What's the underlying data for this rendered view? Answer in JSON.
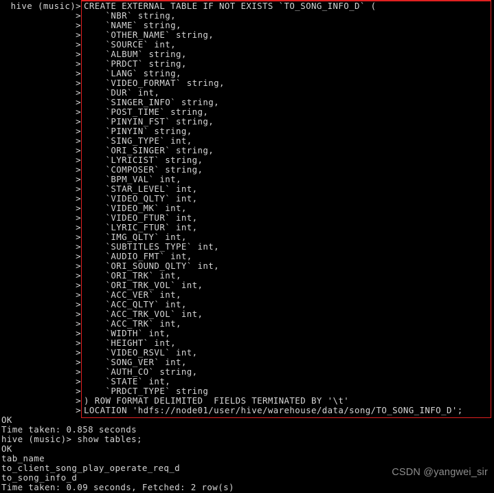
{
  "terminal": {
    "app": "hive-cli",
    "prompt": "hive (music)>",
    "continuation_prompt": ">",
    "background_color": "#000000",
    "text_color": "#d6d6d6",
    "highlight_box_color": "#e02020"
  },
  "watermark": {
    "text": "CSDN @yangwei_sir"
  },
  "session": {
    "lines": [
      {
        "gutter": "hive (music)>",
        "content": "CREATE EXTERNAL TABLE IF NOT EXISTS `TO_SONG_INFO_D` ("
      },
      {
        "gutter": ">",
        "content": "    `NBR` string,"
      },
      {
        "gutter": ">",
        "content": "    `NAME` string,"
      },
      {
        "gutter": ">",
        "content": "    `OTHER_NAME` string,"
      },
      {
        "gutter": ">",
        "content": "    `SOURCE` int,"
      },
      {
        "gutter": ">",
        "content": "    `ALBUM` string,"
      },
      {
        "gutter": ">",
        "content": "    `PRDCT` string,"
      },
      {
        "gutter": ">",
        "content": "    `LANG` string,"
      },
      {
        "gutter": ">",
        "content": "    `VIDEO_FORMAT` string,"
      },
      {
        "gutter": ">",
        "content": "    `DUR` int,"
      },
      {
        "gutter": ">",
        "content": "    `SINGER_INFO` string,"
      },
      {
        "gutter": ">",
        "content": "    `POST_TIME` string,"
      },
      {
        "gutter": ">",
        "content": "    `PINYIN_FST` string,"
      },
      {
        "gutter": ">",
        "content": "    `PINYIN` string,"
      },
      {
        "gutter": ">",
        "content": "    `SING_TYPE` int,"
      },
      {
        "gutter": ">",
        "content": "    `ORI_SINGER` string,"
      },
      {
        "gutter": ">",
        "content": "    `LYRICIST` string,"
      },
      {
        "gutter": ">",
        "content": "    `COMPOSER` string,"
      },
      {
        "gutter": ">",
        "content": "    `BPM_VAL` int,"
      },
      {
        "gutter": ">",
        "content": "    `STAR_LEVEL` int,"
      },
      {
        "gutter": ">",
        "content": "    `VIDEO_QLTY` int,"
      },
      {
        "gutter": ">",
        "content": "    `VIDEO_MK` int,"
      },
      {
        "gutter": ">",
        "content": "    `VIDEO_FTUR` int,"
      },
      {
        "gutter": ">",
        "content": "    `LYRIC_FTUR` int,"
      },
      {
        "gutter": ">",
        "content": "    `IMG_QLTY` int,"
      },
      {
        "gutter": ">",
        "content": "    `SUBTITLES_TYPE` int,"
      },
      {
        "gutter": ">",
        "content": "    `AUDIO_FMT` int,"
      },
      {
        "gutter": ">",
        "content": "    `ORI_SOUND_QLTY` int,"
      },
      {
        "gutter": ">",
        "content": "    `ORI_TRK` int,"
      },
      {
        "gutter": ">",
        "content": "    `ORI_TRK_VOL` int,"
      },
      {
        "gutter": ">",
        "content": "    `ACC_VER` int,"
      },
      {
        "gutter": ">",
        "content": "    `ACC_QLTY` int,"
      },
      {
        "gutter": ">",
        "content": "    `ACC_TRK_VOL` int,"
      },
      {
        "gutter": ">",
        "content": "    `ACC_TRK` int,"
      },
      {
        "gutter": ">",
        "content": "    `WIDTH` int,"
      },
      {
        "gutter": ">",
        "content": "    `HEIGHT` int,"
      },
      {
        "gutter": ">",
        "content": "    `VIDEO_RSVL` int,"
      },
      {
        "gutter": ">",
        "content": "    `SONG_VER` int,"
      },
      {
        "gutter": ">",
        "content": "    `AUTH_CO` string,"
      },
      {
        "gutter": ">",
        "content": "    `STATE` int,"
      },
      {
        "gutter": ">",
        "content": "    `PRDCT_TYPE` string"
      },
      {
        "gutter": ">",
        "content": ") ROW FORMAT DELIMITED  FIELDS TERMINATED BY '\\t'"
      },
      {
        "gutter": ">",
        "content": "LOCATION 'hdfs://node01/user/hive/warehouse/data/song/TO_SONG_INFO_D';"
      }
    ],
    "output": [
      {
        "text": "OK"
      },
      {
        "text": "Time taken: 0.858 seconds"
      },
      {
        "text": "hive (music)> show tables;"
      },
      {
        "text": "OK"
      },
      {
        "text": "tab_name"
      },
      {
        "text": "to_client_song_play_operate_req_d"
      },
      {
        "text": "to_song_info_d"
      },
      {
        "text": "Time taken: 0.09 seconds, Fetched: 2 row(s)"
      }
    ]
  }
}
